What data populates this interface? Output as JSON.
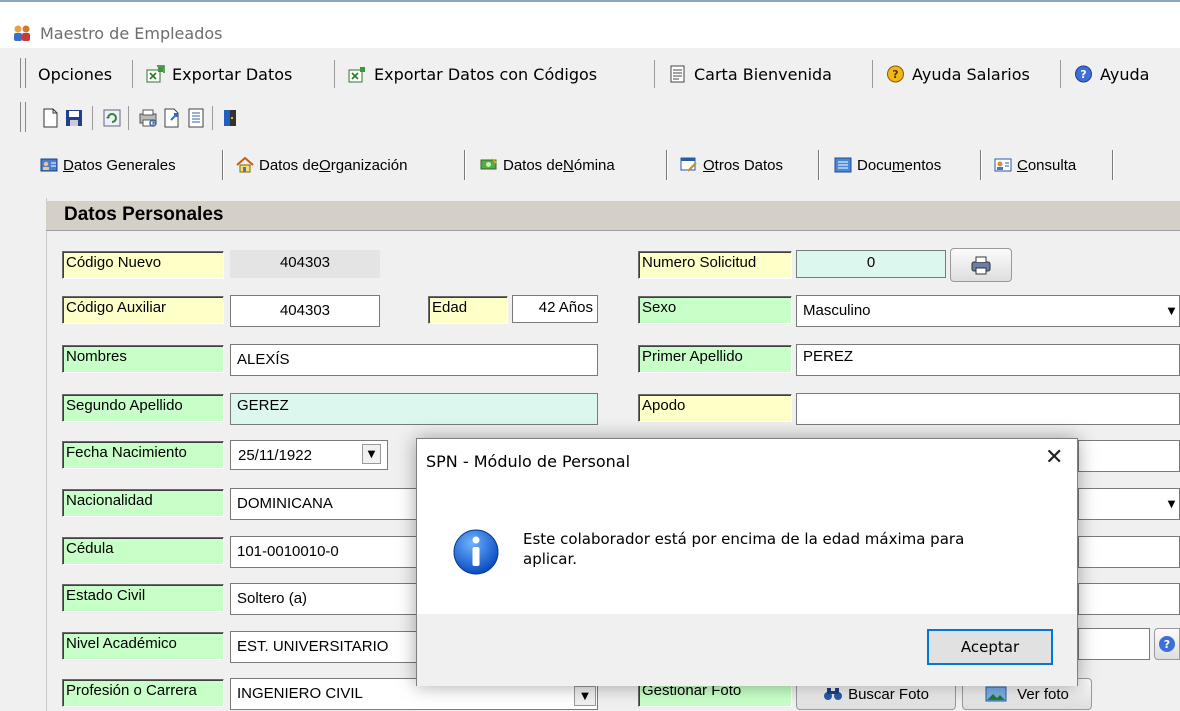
{
  "window": {
    "title": "Maestro de Empleados"
  },
  "menu": {
    "opciones": "Opciones",
    "exportar": "Exportar Datos",
    "exportar_codigos": "Exportar Datos con Códigos",
    "carta": "Carta Bienvenida",
    "ayuda_salarios": "Ayuda Salarios",
    "ayuda": "Ayuda"
  },
  "tabs": {
    "generales": {
      "pre": "",
      "key": "D",
      "post": "atos Generales"
    },
    "organizacion": {
      "pre": "Datos de ",
      "key": "O",
      "post": "rganización"
    },
    "nomina": {
      "pre": "Datos de ",
      "key": "N",
      "post": "ómina"
    },
    "otros": {
      "pre": "",
      "key": "O",
      "post": "tros Datos"
    },
    "documentos": {
      "pre": "Docu",
      "key": "m",
      "post": "entos"
    },
    "consulta": {
      "pre": "",
      "key": "C",
      "post": "onsulta"
    }
  },
  "section": {
    "title": "Datos Personales"
  },
  "form": {
    "codigo_nuevo": {
      "label": "Código Nuevo",
      "value": "404303"
    },
    "codigo_auxiliar": {
      "label": "Código Auxiliar",
      "value": "404303"
    },
    "edad": {
      "label": "Edad",
      "value": "42 Años"
    },
    "nombres": {
      "label": "Nombres",
      "value": "ALEXÍS"
    },
    "segundo_apellido": {
      "label": "Segundo Apellido",
      "value": "GEREZ"
    },
    "fecha_nacimiento": {
      "label": "Fecha Nacimiento",
      "value": "25/11/1922"
    },
    "nacionalidad": {
      "label": "Nacionalidad",
      "value": "DOMINICANA"
    },
    "cedula": {
      "label": "Cédula",
      "value": "101-0010010-0"
    },
    "estado_civil": {
      "label": "Estado Civil",
      "value": "Soltero (a)"
    },
    "nivel_academico": {
      "label": "Nivel Académico",
      "value": "EST. UNIVERSITARIO"
    },
    "profesion": {
      "label": "Profesión o Carrera",
      "value": "INGENIERO CIVIL"
    },
    "numero_solicitud": {
      "label": "Numero Solicitud",
      "value": "0"
    },
    "sexo": {
      "label": "Sexo",
      "value": "Masculino"
    },
    "primer_apellido": {
      "label": "Primer Apellido",
      "value": "PEREZ"
    },
    "apodo": {
      "label": "Apodo",
      "value": ""
    },
    "gestionar_foto": {
      "label": "Gestionar Foto"
    },
    "buscar_foto": "Buscar Foto",
    "ver_foto": "Ver foto"
  },
  "dialog": {
    "title": "SPN - Módulo de Personal",
    "close": "✕",
    "message": "Este colaborador está por encima de la edad máxima para aplicar.",
    "ok": "Aceptar"
  },
  "colors": {
    "label_yellow": "#ffffc8",
    "label_green": "#c8ffc8",
    "accent": "#0078d7"
  }
}
